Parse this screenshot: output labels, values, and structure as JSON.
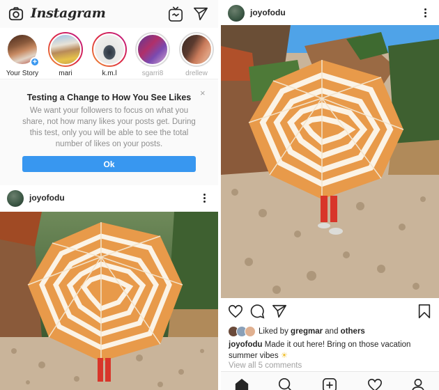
{
  "left_screen": {
    "app_title": "Instagram",
    "top_bar": {
      "camera_icon": "camera-icon",
      "igtv_icon": "igtv-icon",
      "direct_icon": "paper-plane-icon"
    },
    "stories": [
      {
        "name": "Your Story",
        "state": "own",
        "has_add_badge": true
      },
      {
        "name": "mari",
        "state": "unseen"
      },
      {
        "name": "k.m.l",
        "state": "unseen"
      },
      {
        "name": "sgarri8",
        "state": "seen"
      },
      {
        "name": "drellew",
        "state": "seen"
      }
    ],
    "notice": {
      "title": "Testing a Change to How You See Likes",
      "body": "We want your followers to focus on what you share, not how many likes your posts get. During this test, only you will be able to see the total number of likes on your posts.",
      "button_label": "Ok",
      "close_label": "×"
    },
    "post": {
      "username": "joyofodu",
      "more_icon": "more-vertical-icon"
    }
  },
  "right_screen": {
    "post": {
      "username": "joyofodu",
      "more_icon": "more-vertical-icon",
      "actions": [
        "heart-icon",
        "comment-icon",
        "share-icon",
        "bookmark-icon"
      ],
      "liked_by_prefix": "Liked by",
      "liked_by_user": "gregmar",
      "liked_by_and": "and",
      "liked_by_others": "others",
      "caption_user": "joyofodu",
      "caption_text": "Made it out here! Bring on those vacation summer vibes",
      "caption_emoji": "☀",
      "view_comments": "View all 5 comments"
    },
    "bottom_nav": [
      "home-icon",
      "search-icon",
      "add-post-icon",
      "activity-heart-icon",
      "profile-icon"
    ]
  },
  "colors": {
    "accent_blue": "#3897f0",
    "text_primary": "#262626",
    "text_secondary": "#8e8e8e",
    "story_ring_gradient": [
      "#f09433",
      "#dc2743",
      "#bc1888"
    ],
    "background_gray": "#fafafa"
  }
}
